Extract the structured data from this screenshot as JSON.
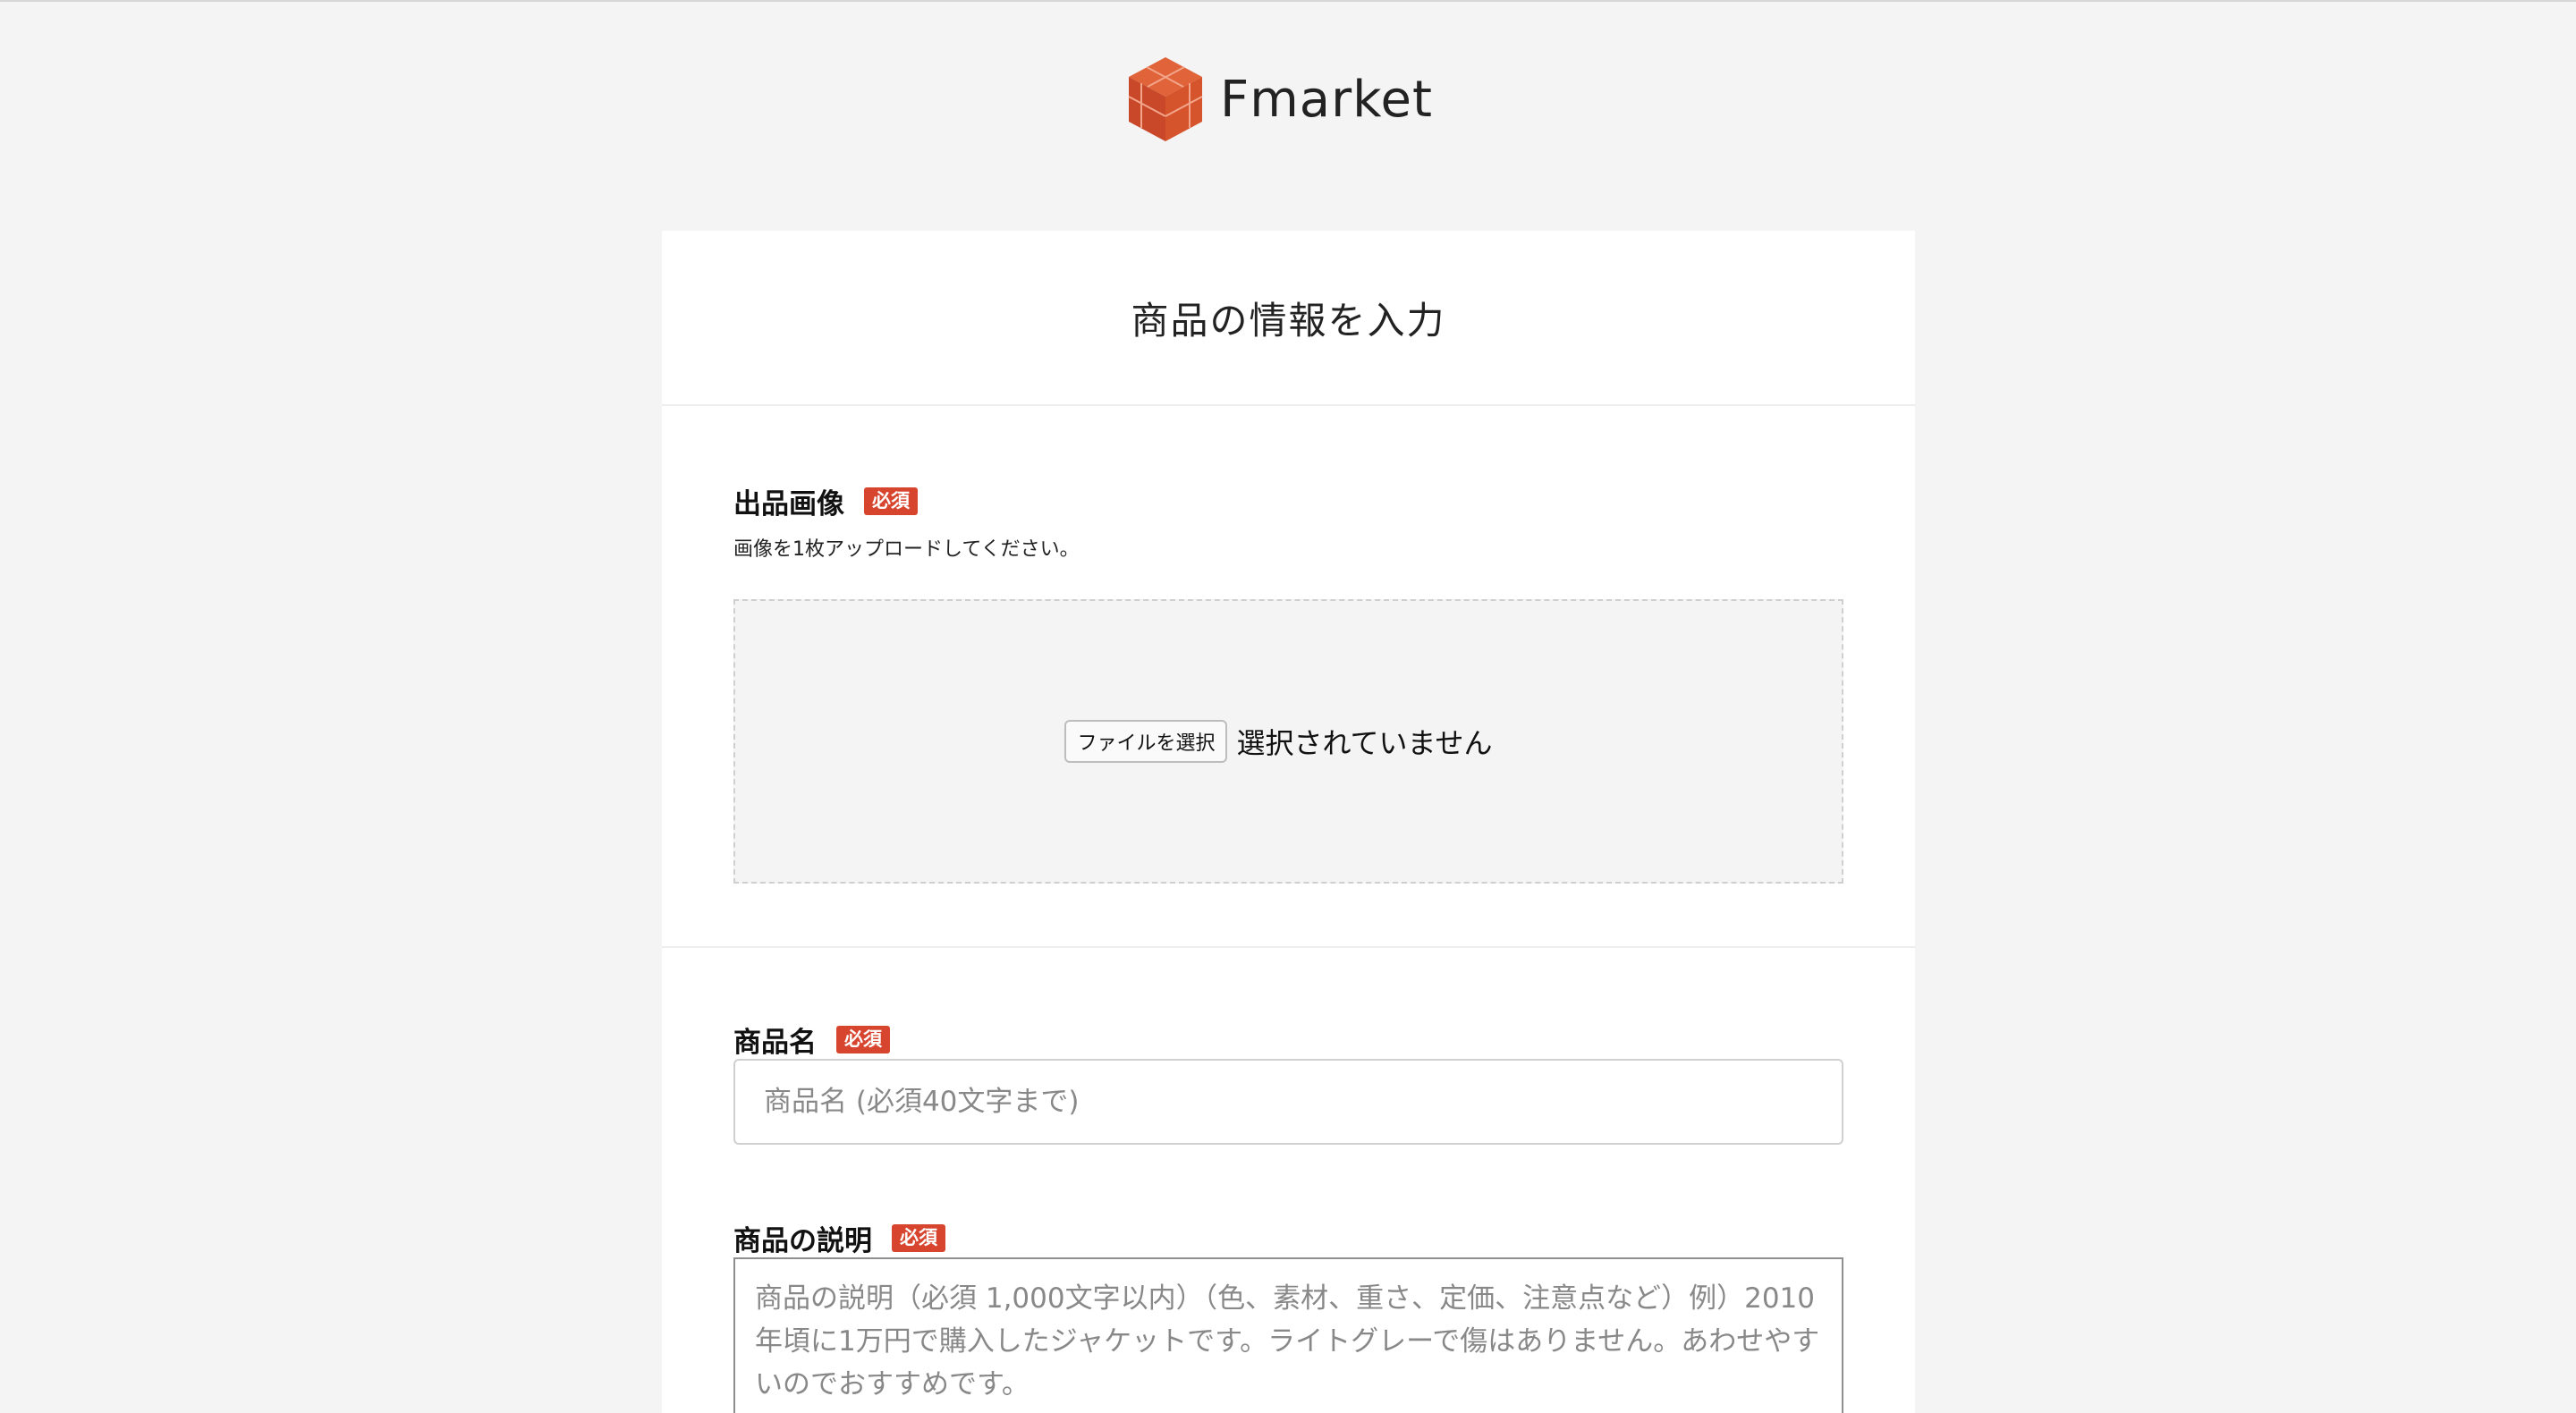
{
  "brand": {
    "name": "Fmarket",
    "logo_icon": "box-icon",
    "accent_color": "#d6542c"
  },
  "page": {
    "title": "商品の情報を入力"
  },
  "image_field": {
    "label": "出品画像",
    "required_badge": "必須",
    "hint": "画像を1枚アップロードしてください。",
    "file_button": "ファイルを選択",
    "file_status": "選択されていません"
  },
  "name_field": {
    "label": "商品名",
    "required_badge": "必須",
    "placeholder": "商品名 (必須40文字まで)"
  },
  "description_field": {
    "label": "商品の説明",
    "required_badge": "必須",
    "placeholder": "商品の説明（必須 1,000文字以内）（色、素材、重さ、定価、注意点など）例）2010年頃に1万円で購入したジャケットです。ライトグレーで傷はありません。あわせやすいのでおすすめです。"
  },
  "colors": {
    "required_badge": "#d8452f",
    "background": "#f4f4f4"
  }
}
